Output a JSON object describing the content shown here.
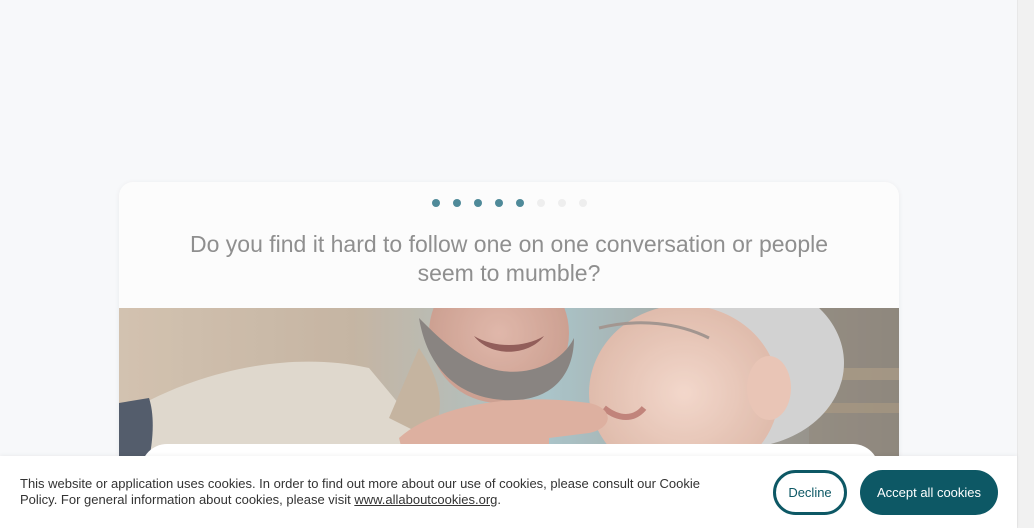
{
  "survey": {
    "progress_dots": {
      "total": 8,
      "completed": 5
    },
    "question": "Do you find it hard to follow one on one conversation or people seem to mumble?"
  },
  "cookie_banner": {
    "text_before": "This website or application uses cookies. In order to find out more about our use of cookies, please consult our Cookie Policy. For general information about cookies, please visit ",
    "link_text": "www.allaboutcookies.org",
    "text_after": ".",
    "decline_label": "Decline",
    "accept_label": "Accept all cookies"
  },
  "colors": {
    "accent": "#0d5865",
    "dot_active": "#4f8a99",
    "dot_inactive": "#eeeeee",
    "question_text": "#8f8f8f",
    "page_background": "#f7f8fa"
  }
}
